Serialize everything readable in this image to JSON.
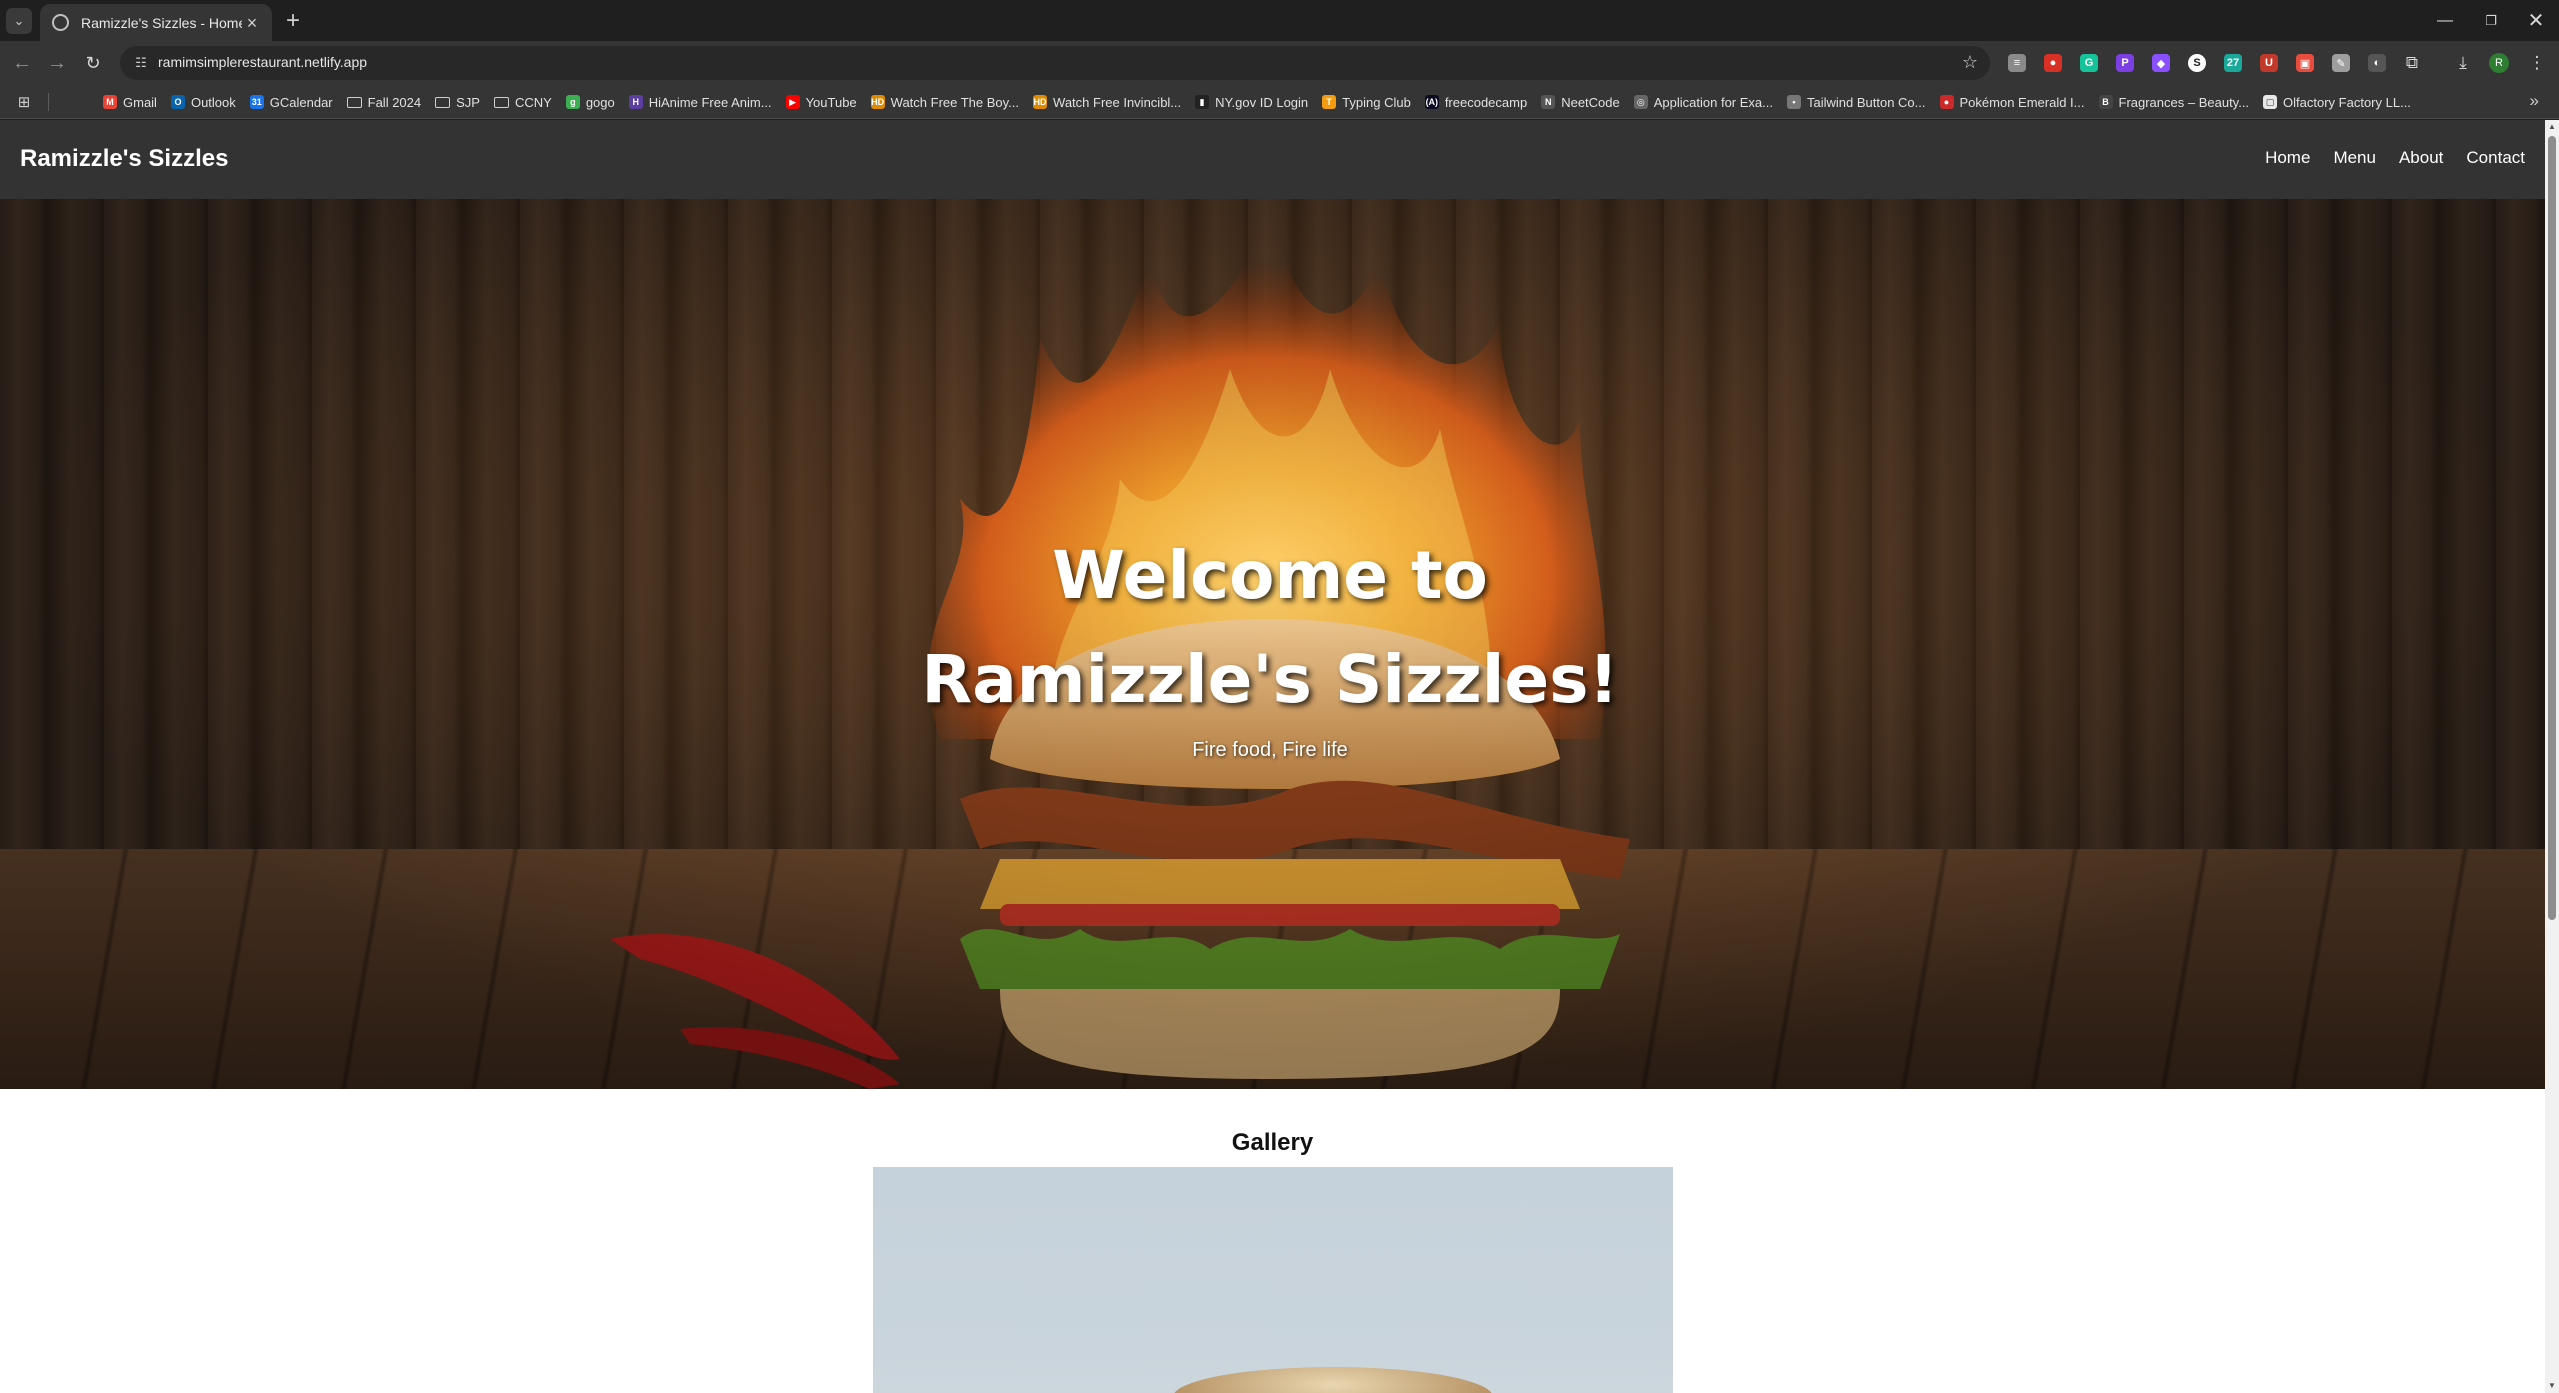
{
  "browser": {
    "tab_title": "Ramizzle's Sizzles - Home",
    "url": "ramimsimplerestaurant.netlify.app",
    "profile_initial": "R",
    "bookmarks": [
      {
        "label": "Gmail",
        "icon": "gmail-icon",
        "color": "#ea4335",
        "glyph": "M"
      },
      {
        "label": "Outlook",
        "icon": "outlook-icon",
        "color": "#0a64ad",
        "glyph": "O"
      },
      {
        "label": "GCalendar",
        "icon": "calendar-icon",
        "color": "#1a73e8",
        "glyph": "31"
      },
      {
        "label": "Fall 2024",
        "icon": "folder-icon",
        "color": "",
        "glyph": ""
      },
      {
        "label": "SJP",
        "icon": "folder-icon",
        "color": "",
        "glyph": ""
      },
      {
        "label": "CCNY",
        "icon": "folder-icon",
        "color": "",
        "glyph": ""
      },
      {
        "label": "gogo",
        "icon": "gogo-icon",
        "color": "#3dae52",
        "glyph": "g"
      },
      {
        "label": "HiAnime Free Anim...",
        "icon": "hianime-icon",
        "color": "#5b3fa0",
        "glyph": "H"
      },
      {
        "label": "YouTube",
        "icon": "youtube-icon",
        "color": "#ff0000",
        "glyph": "▶"
      },
      {
        "label": "Watch Free The Boy...",
        "icon": "hd-icon",
        "color": "#e08a00",
        "glyph": "HD"
      },
      {
        "label": "Watch Free Invincibl...",
        "icon": "hd-icon",
        "color": "#e08a00",
        "glyph": "HD"
      },
      {
        "label": "NY.gov ID Login",
        "icon": "nygov-icon",
        "color": "#222222",
        "glyph": "▮"
      },
      {
        "label": "Typing Club",
        "icon": "typingclub-icon",
        "color": "#f39c12",
        "glyph": "T"
      },
      {
        "label": "freecodecamp",
        "icon": "freecodecamp-icon",
        "color": "#0a0a23",
        "glyph": "(A)"
      },
      {
        "label": "NeetCode",
        "icon": "neetcode-icon",
        "color": "#555555",
        "glyph": "N"
      },
      {
        "label": "Application for Exa...",
        "icon": "globe-icon",
        "color": "#666666",
        "glyph": "◎"
      },
      {
        "label": "Tailwind Button Co...",
        "icon": "tailwind-icon",
        "color": "#777777",
        "glyph": "•"
      },
      {
        "label": "Pokémon Emerald I...",
        "icon": "pokeball-icon",
        "color": "#cc2a2a",
        "glyph": "●"
      },
      {
        "label": "Fragrances – Beauty...",
        "icon": "fragrance-icon",
        "color": "#444444",
        "glyph": "B"
      },
      {
        "label": "Olfactory Factory LL...",
        "icon": "olfactory-icon",
        "color": "#e8e8e8",
        "glyph": "▢"
      }
    ],
    "extensions": [
      {
        "icon": "notes-extension-icon",
        "color": "#8a8a8a",
        "glyph": "≡"
      },
      {
        "icon": "adblock-extension-icon",
        "color": "#d93025",
        "glyph": "●"
      },
      {
        "icon": "grammarly-extension-icon",
        "color": "#15c39a",
        "glyph": "G"
      },
      {
        "icon": "purple-extension-icon",
        "color": "#7b3fe4",
        "glyph": "P"
      },
      {
        "icon": "shield-extension-icon",
        "color": "#8a4fff",
        "glyph": "◆"
      },
      {
        "icon": "s-extension-icon",
        "color": "#ffffff",
        "glyph": "S"
      },
      {
        "icon": "teal-extension-icon",
        "color": "#1aa89a",
        "glyph": "27"
      },
      {
        "icon": "ub-extension-icon",
        "color": "#c0392b",
        "glyph": "U"
      },
      {
        "icon": "red-extension-icon",
        "color": "#e74c3c",
        "glyph": "▣"
      },
      {
        "icon": "note-extension-icon",
        "color": "#9e9e9e",
        "glyph": "✎"
      },
      {
        "icon": "dark-extension-icon",
        "color": "#555555",
        "glyph": "◐"
      }
    ]
  },
  "site": {
    "logo": "Ramizzle's Sizzles",
    "nav": [
      "Home",
      "Menu",
      "About",
      "Contact"
    ],
    "hero_title": "Welcome to Ramizzle's Sizzles!",
    "hero_subtitle": "Fire food, Fire life",
    "gallery_title": "Gallery"
  }
}
